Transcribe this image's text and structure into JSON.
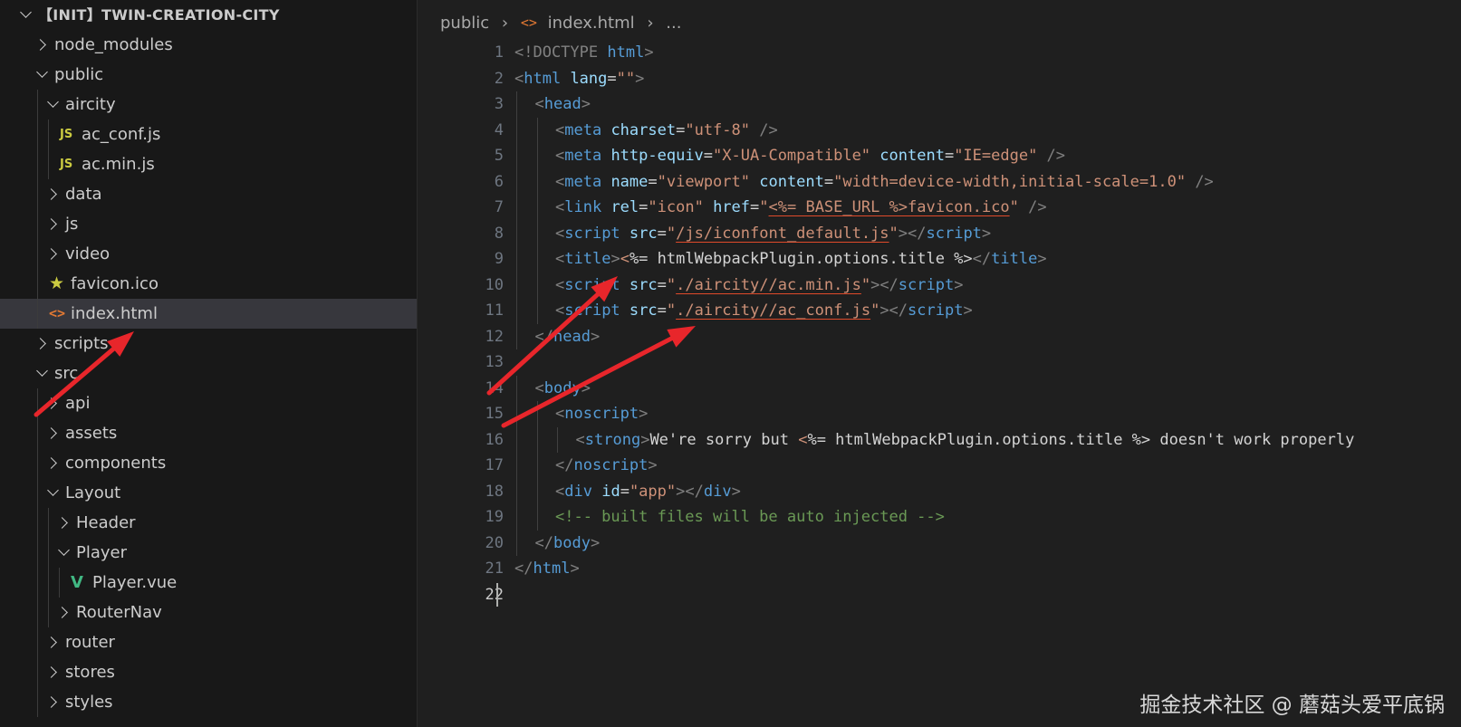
{
  "explorer": {
    "root_label": "【INIT】TWIN-CREATION-CITY",
    "items": [
      {
        "label": "node_modules",
        "depth": 1,
        "kind": "folder",
        "open": false
      },
      {
        "label": "public",
        "depth": 1,
        "kind": "folder",
        "open": true
      },
      {
        "label": "aircity",
        "depth": 2,
        "kind": "folder",
        "open": true
      },
      {
        "label": "ac_conf.js",
        "depth": 3,
        "kind": "js"
      },
      {
        "label": "ac.min.js",
        "depth": 3,
        "kind": "js"
      },
      {
        "label": "data",
        "depth": 2,
        "kind": "folder",
        "open": false
      },
      {
        "label": "js",
        "depth": 2,
        "kind": "folder",
        "open": false
      },
      {
        "label": "video",
        "depth": 2,
        "kind": "folder",
        "open": false
      },
      {
        "label": "favicon.ico",
        "depth": 2,
        "kind": "star"
      },
      {
        "label": "index.html",
        "depth": 2,
        "kind": "html",
        "selected": true
      },
      {
        "label": "scripts",
        "depth": 1,
        "kind": "folder",
        "open": false
      },
      {
        "label": "src",
        "depth": 1,
        "kind": "folder",
        "open": true
      },
      {
        "label": "api",
        "depth": 2,
        "kind": "folder",
        "open": false
      },
      {
        "label": "assets",
        "depth": 2,
        "kind": "folder",
        "open": false
      },
      {
        "label": "components",
        "depth": 2,
        "kind": "folder",
        "open": false
      },
      {
        "label": "Layout",
        "depth": 2,
        "kind": "folder",
        "open": true
      },
      {
        "label": "Header",
        "depth": 3,
        "kind": "folder",
        "open": false
      },
      {
        "label": "Player",
        "depth": 3,
        "kind": "folder",
        "open": true
      },
      {
        "label": "Player.vue",
        "depth": 4,
        "kind": "vue"
      },
      {
        "label": "RouterNav",
        "depth": 3,
        "kind": "folder",
        "open": false
      },
      {
        "label": "router",
        "depth": 2,
        "kind": "folder",
        "open": false
      },
      {
        "label": "stores",
        "depth": 2,
        "kind": "folder",
        "open": false
      },
      {
        "label": "styles",
        "depth": 2,
        "kind": "folder",
        "open": false
      }
    ],
    "icon_text": {
      "js": "JS",
      "html": "<>",
      "star": "★",
      "vue": "V"
    }
  },
  "breadcrumb": {
    "folder": "public",
    "file": "index.html",
    "more": "..."
  },
  "editor": {
    "active_line": 22,
    "lines": [
      {
        "n": "1",
        "indent": 0,
        "tokens": [
          {
            "t": "<!DOCTYPE",
            "c": "punc"
          },
          {
            "t": " html",
            "c": "tag"
          },
          {
            "t": ">",
            "c": "punc"
          }
        ]
      },
      {
        "n": "2",
        "indent": 0,
        "tokens": [
          {
            "t": "<",
            "c": "punc"
          },
          {
            "t": "html",
            "c": "tag"
          },
          {
            "t": " lang",
            "c": "attr"
          },
          {
            "t": "=",
            "c": "text"
          },
          {
            "t": "\"\"",
            "c": "str"
          },
          {
            "t": ">",
            "c": "punc"
          }
        ]
      },
      {
        "n": "3",
        "indent": 1,
        "tokens": [
          {
            "t": "<",
            "c": "punc"
          },
          {
            "t": "head",
            "c": "tag"
          },
          {
            "t": ">",
            "c": "punc"
          }
        ]
      },
      {
        "n": "4",
        "indent": 2,
        "tokens": [
          {
            "t": "<",
            "c": "punc"
          },
          {
            "t": "meta",
            "c": "tag"
          },
          {
            "t": " charset",
            "c": "attr"
          },
          {
            "t": "=",
            "c": "text"
          },
          {
            "t": "\"utf-8\"",
            "c": "str"
          },
          {
            "t": " />",
            "c": "punc"
          }
        ]
      },
      {
        "n": "5",
        "indent": 2,
        "tokens": [
          {
            "t": "<",
            "c": "punc"
          },
          {
            "t": "meta",
            "c": "tag"
          },
          {
            "t": " http-equiv",
            "c": "attr"
          },
          {
            "t": "=",
            "c": "text"
          },
          {
            "t": "\"X-UA-Compatible\"",
            "c": "str"
          },
          {
            "t": " content",
            "c": "attr"
          },
          {
            "t": "=",
            "c": "text"
          },
          {
            "t": "\"IE=edge\"",
            "c": "str"
          },
          {
            "t": " />",
            "c": "punc"
          }
        ]
      },
      {
        "n": "6",
        "indent": 2,
        "tokens": [
          {
            "t": "<",
            "c": "punc"
          },
          {
            "t": "meta",
            "c": "tag"
          },
          {
            "t": " name",
            "c": "attr"
          },
          {
            "t": "=",
            "c": "text"
          },
          {
            "t": "\"viewport\"",
            "c": "str"
          },
          {
            "t": " content",
            "c": "attr"
          },
          {
            "t": "=",
            "c": "text"
          },
          {
            "t": "\"width=device-width,initial-scale=1.0\"",
            "c": "str"
          },
          {
            "t": " />",
            "c": "punc"
          }
        ]
      },
      {
        "n": "7",
        "indent": 2,
        "tokens": [
          {
            "t": "<",
            "c": "punc"
          },
          {
            "t": "link",
            "c": "tag"
          },
          {
            "t": " rel",
            "c": "attr"
          },
          {
            "t": "=",
            "c": "text"
          },
          {
            "t": "\"icon\"",
            "c": "str"
          },
          {
            "t": " href",
            "c": "attr"
          },
          {
            "t": "=",
            "c": "text"
          },
          {
            "t": "\"",
            "c": "str"
          },
          {
            "t": "<%= BASE_URL %>favicon.ico",
            "c": "str",
            "u": true
          },
          {
            "t": "\"",
            "c": "str"
          },
          {
            "t": " />",
            "c": "punc"
          }
        ]
      },
      {
        "n": "8",
        "indent": 2,
        "tokens": [
          {
            "t": "<",
            "c": "punc"
          },
          {
            "t": "script",
            "c": "tag"
          },
          {
            "t": " src",
            "c": "attr"
          },
          {
            "t": "=",
            "c": "text"
          },
          {
            "t": "\"",
            "c": "str"
          },
          {
            "t": "/js/iconfont_default.js",
            "c": "str",
            "u": true
          },
          {
            "t": "\"",
            "c": "str"
          },
          {
            "t": "></",
            "c": "punc"
          },
          {
            "t": "script",
            "c": "tag"
          },
          {
            "t": ">",
            "c": "punc"
          }
        ]
      },
      {
        "n": "9",
        "indent": 2,
        "tokens": [
          {
            "t": "<",
            "c": "punc"
          },
          {
            "t": "title",
            "c": "tag"
          },
          {
            "t": ">",
            "c": "punc"
          },
          {
            "t": "<",
            "c": "str"
          },
          {
            "t": "%= htmlWebpackPlugin.options.title %>",
            "c": "text"
          },
          {
            "t": "</",
            "c": "punc"
          },
          {
            "t": "title",
            "c": "tag"
          },
          {
            "t": ">",
            "c": "punc"
          }
        ]
      },
      {
        "n": "10",
        "indent": 2,
        "tokens": [
          {
            "t": "<",
            "c": "punc"
          },
          {
            "t": "script",
            "c": "tag"
          },
          {
            "t": " src",
            "c": "attr"
          },
          {
            "t": "=",
            "c": "text"
          },
          {
            "t": "\"",
            "c": "str"
          },
          {
            "t": "./aircity//ac.min.js",
            "c": "str",
            "u": true
          },
          {
            "t": "\"",
            "c": "str"
          },
          {
            "t": "></",
            "c": "punc"
          },
          {
            "t": "script",
            "c": "tag"
          },
          {
            "t": ">",
            "c": "punc"
          }
        ]
      },
      {
        "n": "11",
        "indent": 2,
        "tokens": [
          {
            "t": "<",
            "c": "punc"
          },
          {
            "t": "script",
            "c": "tag"
          },
          {
            "t": " src",
            "c": "attr"
          },
          {
            "t": "=",
            "c": "text"
          },
          {
            "t": "\"",
            "c": "str"
          },
          {
            "t": "./aircity//ac_conf.js",
            "c": "str",
            "u": true
          },
          {
            "t": "\"",
            "c": "str"
          },
          {
            "t": "></",
            "c": "punc"
          },
          {
            "t": "script",
            "c": "tag"
          },
          {
            "t": ">",
            "c": "punc"
          }
        ]
      },
      {
        "n": "12",
        "indent": 1,
        "tokens": [
          {
            "t": "</",
            "c": "punc"
          },
          {
            "t": "head",
            "c": "tag"
          },
          {
            "t": ">",
            "c": "punc"
          }
        ]
      },
      {
        "n": "13",
        "indent": 0,
        "tokens": []
      },
      {
        "n": "14",
        "indent": 1,
        "tokens": [
          {
            "t": "<",
            "c": "punc"
          },
          {
            "t": "body",
            "c": "tag"
          },
          {
            "t": ">",
            "c": "punc"
          }
        ]
      },
      {
        "n": "15",
        "indent": 2,
        "tokens": [
          {
            "t": "<",
            "c": "punc"
          },
          {
            "t": "noscript",
            "c": "tag"
          },
          {
            "t": ">",
            "c": "punc"
          }
        ]
      },
      {
        "n": "16",
        "indent": 3,
        "tokens": [
          {
            "t": "<",
            "c": "punc"
          },
          {
            "t": "strong",
            "c": "tag"
          },
          {
            "t": ">",
            "c": "punc"
          },
          {
            "t": "We're sorry but ",
            "c": "text"
          },
          {
            "t": "<",
            "c": "str"
          },
          {
            "t": "%= htmlWebpackPlugin.options.title %> doesn't work properly",
            "c": "text"
          }
        ]
      },
      {
        "n": "17",
        "indent": 2,
        "tokens": [
          {
            "t": "</",
            "c": "punc"
          },
          {
            "t": "noscript",
            "c": "tag"
          },
          {
            "t": ">",
            "c": "punc"
          }
        ]
      },
      {
        "n": "18",
        "indent": 2,
        "tokens": [
          {
            "t": "<",
            "c": "punc"
          },
          {
            "t": "div",
            "c": "tag"
          },
          {
            "t": " id",
            "c": "attr"
          },
          {
            "t": "=",
            "c": "text"
          },
          {
            "t": "\"app\"",
            "c": "str"
          },
          {
            "t": "></",
            "c": "punc"
          },
          {
            "t": "div",
            "c": "tag"
          },
          {
            "t": ">",
            "c": "punc"
          }
        ]
      },
      {
        "n": "19",
        "indent": 2,
        "tokens": [
          {
            "t": "<!-- built files will be auto injected -->",
            "c": "com"
          }
        ]
      },
      {
        "n": "20",
        "indent": 1,
        "tokens": [
          {
            "t": "</",
            "c": "punc"
          },
          {
            "t": "body",
            "c": "tag"
          },
          {
            "t": ">",
            "c": "punc"
          }
        ]
      },
      {
        "n": "21",
        "indent": 0,
        "tokens": [
          {
            "t": "</",
            "c": "punc"
          },
          {
            "t": "html",
            "c": "tag"
          },
          {
            "t": ">",
            "c": "punc"
          }
        ]
      },
      {
        "n": "22",
        "indent": 0,
        "tokens": []
      }
    ]
  },
  "annotation": {
    "arrow_color": "#e8262b"
  },
  "watermark": "掘金技术社区 @ 蘑菇头爱平底锅"
}
